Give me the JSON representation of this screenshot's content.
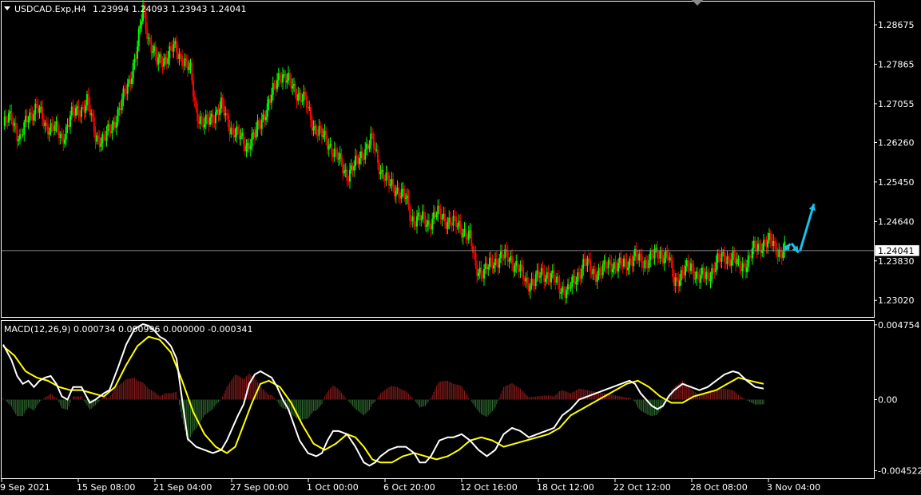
{
  "colors": {
    "background": "#000000",
    "axis": "#ffffff",
    "bull_candle": "#00ff00",
    "bear_candle": "#ff0000",
    "macd_line": "#ffffff",
    "signal_line": "#ffff00",
    "hist_pos": "#8b1a1a",
    "hist_neg": "#2e6b2e",
    "price_line": "#8a8a8a",
    "arrows": "#19c3e6"
  },
  "header": {
    "symbol_label": "USDCAD.Exp,H4",
    "ohlc": "1.23994 1.24093 1.23943 1.24041"
  },
  "macd_header": {
    "label": "MACD(12,26,9) 0.000734 0.000996 0.000000 -0.000341"
  },
  "icons": {
    "collapse": "triangle-down-icon",
    "scroll_marker": "triangle-marker-icon"
  },
  "chart_data": [
    {
      "type": "candlestick",
      "title": "USDCAD.Exp,H4",
      "y_tick_labels": [
        "1.28675",
        "1.27865",
        "1.27055",
        "1.26260",
        "1.25450",
        "1.24640",
        "1.23830",
        "1.23020"
      ],
      "ylim": [
        1.2268,
        1.2915
      ],
      "current_price_label": "1.24041",
      "current_price": 1.24041,
      "x_tick_labels": [
        "9 Sep 2021",
        "15 Sep 08:00",
        "21 Sep 04:00",
        "27 Sep 00:00",
        "1 Oct 00:00",
        "6 Oct 20:00",
        "12 Oct 16:00",
        "18 Oct 12:00",
        "22 Oct 12:00",
        "28 Oct 08:00",
        "3 Nov 04:00"
      ],
      "close_path": [
        [
          0,
          1.266
        ],
        [
          6,
          1.268
        ],
        [
          12,
          1.263
        ],
        [
          18,
          1.268
        ],
        [
          24,
          1.27
        ],
        [
          30,
          1.266
        ],
        [
          36,
          1.266
        ],
        [
          42,
          1.263
        ],
        [
          48,
          1.268
        ],
        [
          54,
          1.269
        ],
        [
          60,
          1.271
        ],
        [
          66,
          1.264
        ],
        [
          72,
          1.263
        ],
        [
          78,
          1.266
        ],
        [
          84,
          1.27
        ],
        [
          90,
          1.275
        ],
        [
          96,
          1.282
        ],
        [
          100,
          1.29
        ],
        [
          104,
          1.284
        ],
        [
          110,
          1.279
        ],
        [
          116,
          1.28
        ],
        [
          122,
          1.282
        ],
        [
          128,
          1.28
        ],
        [
          134,
          1.277
        ],
        [
          138,
          1.269
        ],
        [
          144,
          1.266
        ],
        [
          150,
          1.268
        ],
        [
          156,
          1.27
        ],
        [
          162,
          1.266
        ],
        [
          168,
          1.264
        ],
        [
          174,
          1.262
        ],
        [
          180,
          1.264
        ],
        [
          186,
          1.268
        ],
        [
          192,
          1.272
        ],
        [
          198,
          1.277
        ],
        [
          204,
          1.275
        ],
        [
          210,
          1.273
        ],
        [
          216,
          1.271
        ],
        [
          222,
          1.266
        ],
        [
          228,
          1.264
        ],
        [
          234,
          1.262
        ],
        [
          240,
          1.259
        ],
        [
          246,
          1.256
        ],
        [
          252,
          1.258
        ],
        [
          258,
          1.261
        ],
        [
          264,
          1.263
        ],
        [
          270,
          1.257
        ],
        [
          276,
          1.254
        ],
        [
          282,
          1.253
        ],
        [
          288,
          1.251
        ],
        [
          292,
          1.247
        ],
        [
          298,
          1.247
        ],
        [
          304,
          1.246
        ],
        [
          310,
          1.248
        ],
        [
          316,
          1.247
        ],
        [
          322,
          1.246
        ],
        [
          328,
          1.245
        ],
        [
          334,
          1.243
        ],
        [
          338,
          1.237
        ],
        [
          344,
          1.236
        ],
        [
          350,
          1.238
        ],
        [
          356,
          1.239
        ],
        [
          362,
          1.239
        ],
        [
          368,
          1.237
        ],
        [
          374,
          1.234
        ],
        [
          380,
          1.234
        ],
        [
          386,
          1.236
        ],
        [
          392,
          1.235
        ],
        [
          398,
          1.233
        ],
        [
          404,
          1.232
        ],
        [
          410,
          1.235
        ],
        [
          416,
          1.238
        ],
        [
          422,
          1.236
        ],
        [
          428,
          1.236
        ],
        [
          434,
          1.238
        ],
        [
          440,
          1.237
        ],
        [
          446,
          1.238
        ],
        [
          452,
          1.239
        ],
        [
          458,
          1.238
        ],
        [
          464,
          1.239
        ],
        [
          470,
          1.24
        ],
        [
          476,
          1.239
        ],
        [
          480,
          1.234
        ],
        [
          486,
          1.236
        ],
        [
          492,
          1.237
        ],
        [
          498,
          1.235
        ],
        [
          504,
          1.235
        ],
        [
          510,
          1.238
        ],
        [
          516,
          1.239
        ],
        [
          522,
          1.239
        ],
        [
          526,
          1.237
        ],
        [
          532,
          1.238
        ],
        [
          538,
          1.241
        ],
        [
          544,
          1.242
        ],
        [
          550,
          1.242
        ],
        [
          556,
          1.24
        ],
        [
          559,
          1.2404
        ]
      ],
      "forecast_arrows": [
        [
          [
            559,
            1.2404
          ],
          [
            563,
            1.2418
          ]
        ],
        [
          [
            564,
            1.2419
          ],
          [
            569,
            1.24
          ]
        ],
        [
          [
            570,
            1.2403
          ],
          [
            580,
            1.25
          ]
        ]
      ]
    },
    {
      "type": "macd",
      "title": "MACD(12,26,9)",
      "params": [
        12,
        26,
        9
      ],
      "values": {
        "macd": 0.000734,
        "signal": 0.000996,
        "histogram": 0.0,
        "last": -0.000341
      },
      "y_tick_labels": [
        "0.004754",
        "0.00",
        "-0.004522"
      ],
      "ylim": [
        -0.005,
        0.005
      ],
      "macd_path": [
        [
          0,
          0.0035
        ],
        [
          6,
          0.0025
        ],
        [
          10,
          0.0015
        ],
        [
          14,
          0.001
        ],
        [
          18,
          0.0012
        ],
        [
          22,
          0.0008
        ],
        [
          26,
          0.0012
        ],
        [
          30,
          0.0014
        ],
        [
          34,
          0.0015
        ],
        [
          38,
          0.001
        ],
        [
          42,
          0.0002
        ],
        [
          46,
          0.0
        ],
        [
          50,
          0.0008
        ],
        [
          56,
          0.0008
        ],
        [
          62,
          -0.0002
        ],
        [
          66,
          0.0
        ],
        [
          72,
          0.0004
        ],
        [
          76,
          0.0006
        ],
        [
          82,
          0.002
        ],
        [
          88,
          0.0035
        ],
        [
          94,
          0.0045
        ],
        [
          100,
          0.0048
        ],
        [
          104,
          0.0047
        ],
        [
          108,
          0.0044
        ],
        [
          112,
          0.004
        ],
        [
          116,
          0.0038
        ],
        [
          120,
          0.0034
        ],
        [
          124,
          0.0026
        ],
        [
          128,
          0.0
        ],
        [
          132,
          -0.0025
        ],
        [
          138,
          -0.003
        ],
        [
          144,
          -0.0032
        ],
        [
          150,
          -0.0034
        ],
        [
          156,
          -0.0032
        ],
        [
          160,
          -0.0026
        ],
        [
          164,
          -0.0018
        ],
        [
          168,
          -0.001
        ],
        [
          172,
          -0.0003
        ],
        [
          176,
          0.001
        ],
        [
          180,
          0.0016
        ],
        [
          184,
          0.0018
        ],
        [
          188,
          0.0016
        ],
        [
          192,
          0.0014
        ],
        [
          196,
          0.0008
        ],
        [
          200,
          0.0
        ],
        [
          204,
          -0.0006
        ],
        [
          208,
          -0.0016
        ],
        [
          212,
          -0.0026
        ],
        [
          218,
          -0.0034
        ],
        [
          224,
          -0.0036
        ],
        [
          228,
          -0.0034
        ],
        [
          232,
          -0.0026
        ],
        [
          236,
          -0.002
        ],
        [
          240,
          -0.002
        ],
        [
          246,
          -0.0022
        ],
        [
          252,
          -0.003
        ],
        [
          258,
          -0.004
        ],
        [
          262,
          -0.0042
        ],
        [
          266,
          -0.004
        ],
        [
          270,
          -0.0036
        ],
        [
          276,
          -0.0032
        ],
        [
          282,
          -0.003
        ],
        [
          288,
          -0.003
        ],
        [
          294,
          -0.0034
        ],
        [
          298,
          -0.004
        ],
        [
          302,
          -0.004
        ],
        [
          306,
          -0.0036
        ],
        [
          312,
          -0.0026
        ],
        [
          318,
          -0.0024
        ],
        [
          322,
          -0.0024
        ],
        [
          328,
          -0.0022
        ],
        [
          334,
          -0.0026
        ],
        [
          340,
          -0.0032
        ],
        [
          346,
          -0.0036
        ],
        [
          352,
          -0.0032
        ],
        [
          358,
          -0.0022
        ],
        [
          364,
          -0.0018
        ],
        [
          370,
          -0.002
        ],
        [
          376,
          -0.0024
        ],
        [
          382,
          -0.0022
        ],
        [
          388,
          -0.002
        ],
        [
          394,
          -0.0018
        ],
        [
          400,
          -0.001
        ],
        [
          406,
          -0.0006
        ],
        [
          412,
          0.0
        ],
        [
          418,
          0.0002
        ],
        [
          424,
          0.0004
        ],
        [
          430,
          0.0006
        ],
        [
          436,
          0.0008
        ],
        [
          442,
          0.001
        ],
        [
          448,
          0.0012
        ],
        [
          452,
          0.001
        ],
        [
          456,
          0.0004
        ],
        [
          460,
          0.0
        ],
        [
          464,
          -0.0004
        ],
        [
          468,
          -0.0006
        ],
        [
          472,
          -0.0004
        ],
        [
          476,
          0.0002
        ],
        [
          480,
          0.0006
        ],
        [
          486,
          0.001
        ],
        [
          492,
          0.0008
        ],
        [
          498,
          0.0006
        ],
        [
          504,
          0.0008
        ],
        [
          510,
          0.0012
        ],
        [
          516,
          0.0016
        ],
        [
          522,
          0.0018
        ],
        [
          526,
          0.0017
        ],
        [
          532,
          0.0012
        ],
        [
          538,
          0.0008
        ],
        [
          544,
          0.0007
        ]
      ],
      "signal_path": [
        [
          0,
          0.0034
        ],
        [
          8,
          0.0028
        ],
        [
          16,
          0.0018
        ],
        [
          24,
          0.0014
        ],
        [
          32,
          0.0012
        ],
        [
          40,
          0.0008
        ],
        [
          48,
          0.0006
        ],
        [
          56,
          0.0006
        ],
        [
          64,
          0.0004
        ],
        [
          72,
          0.0002
        ],
        [
          80,
          0.0008
        ],
        [
          88,
          0.0022
        ],
        [
          96,
          0.0034
        ],
        [
          104,
          0.004
        ],
        [
          112,
          0.0038
        ],
        [
          120,
          0.003
        ],
        [
          128,
          0.0012
        ],
        [
          136,
          -0.0008
        ],
        [
          144,
          -0.0022
        ],
        [
          152,
          -0.003
        ],
        [
          160,
          -0.0034
        ],
        [
          166,
          -0.003
        ],
        [
          172,
          -0.0016
        ],
        [
          178,
          -0.0002
        ],
        [
          184,
          0.001
        ],
        [
          190,
          0.0012
        ],
        [
          198,
          0.0008
        ],
        [
          206,
          -0.0002
        ],
        [
          214,
          -0.0016
        ],
        [
          222,
          -0.0028
        ],
        [
          230,
          -0.0032
        ],
        [
          238,
          -0.0028
        ],
        [
          246,
          -0.0022
        ],
        [
          252,
          -0.0024
        ],
        [
          258,
          -0.003
        ],
        [
          264,
          -0.0038
        ],
        [
          270,
          -0.004
        ],
        [
          278,
          -0.004
        ],
        [
          286,
          -0.0036
        ],
        [
          294,
          -0.0034
        ],
        [
          302,
          -0.0036
        ],
        [
          310,
          -0.0038
        ],
        [
          318,
          -0.0036
        ],
        [
          326,
          -0.0032
        ],
        [
          334,
          -0.0026
        ],
        [
          342,
          -0.0024
        ],
        [
          350,
          -0.0026
        ],
        [
          358,
          -0.003
        ],
        [
          366,
          -0.0028
        ],
        [
          374,
          -0.0026
        ],
        [
          382,
          -0.0024
        ],
        [
          390,
          -0.0022
        ],
        [
          398,
          -0.0018
        ],
        [
          406,
          -0.001
        ],
        [
          414,
          -0.0006
        ],
        [
          422,
          -0.0002
        ],
        [
          430,
          0.0002
        ],
        [
          438,
          0.0006
        ],
        [
          446,
          0.001
        ],
        [
          454,
          0.0012
        ],
        [
          462,
          0.0008
        ],
        [
          470,
          0.0002
        ],
        [
          478,
          -0.0002
        ],
        [
          486,
          -0.0002
        ],
        [
          494,
          0.0002
        ],
        [
          502,
          0.0004
        ],
        [
          510,
          0.0006
        ],
        [
          518,
          0.001
        ],
        [
          526,
          0.0014
        ],
        [
          534,
          0.0012
        ],
        [
          544,
          0.001
        ]
      ]
    }
  ]
}
